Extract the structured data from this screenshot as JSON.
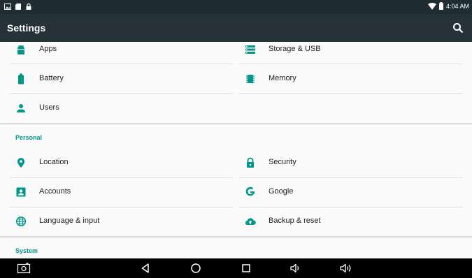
{
  "status_bar": {
    "time": "4:04 AM",
    "left_icons": [
      "image-icon",
      "sd-card-icon",
      "lock-icon"
    ],
    "right_icons": [
      "wifi-icon",
      "battery-icon"
    ]
  },
  "app_bar": {
    "title": "Settings",
    "search_icon": "search-icon"
  },
  "colors": {
    "accent": "#009688",
    "app_bar": "#263238",
    "status_bar": "#1f2d33"
  },
  "settings": {
    "device_left": [
      {
        "label": "Apps",
        "icon": "android-icon"
      },
      {
        "label": "Battery",
        "icon": "battery-icon"
      },
      {
        "label": "Users",
        "icon": "user-icon"
      }
    ],
    "device_right": [
      {
        "label": "Storage & USB",
        "icon": "storage-icon"
      },
      {
        "label": "Memory",
        "icon": "memory-icon"
      }
    ],
    "personal_header": "Personal",
    "personal_left": [
      {
        "label": "Location",
        "icon": "location-pin-icon"
      },
      {
        "label": "Accounts",
        "icon": "account-box-icon"
      },
      {
        "label": "Language & input",
        "icon": "globe-icon"
      }
    ],
    "personal_right": [
      {
        "label": "Security",
        "icon": "lock-icon"
      },
      {
        "label": "Google",
        "icon": "google-icon"
      },
      {
        "label": "Backup & reset",
        "icon": "cloud-upload-icon"
      }
    ],
    "system_header": "System"
  },
  "nav_bar": {
    "items": [
      "screenshot-icon",
      "back-icon",
      "home-icon",
      "recents-icon",
      "volume-down-icon",
      "volume-up-icon"
    ]
  }
}
